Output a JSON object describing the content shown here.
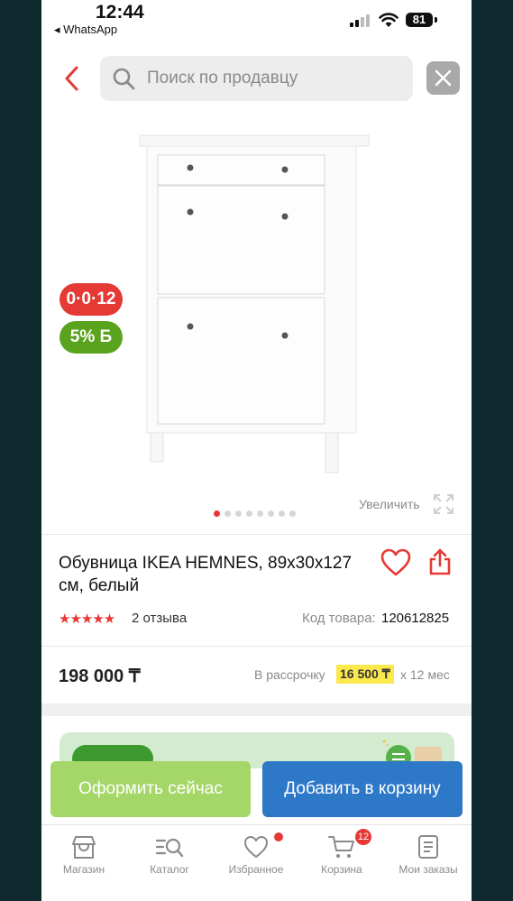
{
  "status_bar": {
    "time": "12:44",
    "back_app": "◂ WhatsApp",
    "battery": "81"
  },
  "search": {
    "placeholder": "Поиск по продавцу"
  },
  "badges": {
    "installment": "0·0·12",
    "bonus": "5%",
    "bonus_currency": "Б"
  },
  "gallery": {
    "zoom_label": "Увеличить",
    "dots_total": 8,
    "active_dot": 0
  },
  "product": {
    "title": "Обувница IKEA HEMNES, 89x30x127 см, белый",
    "rating": 5,
    "reviews": "2 отзыва",
    "code_label": "Код товара:",
    "code_value": "120612825",
    "price": "198 000 ₸",
    "installment_label": "В рассрочку",
    "installment_amount": "16 500 ₸",
    "installment_term": "х 12 мес"
  },
  "actions": {
    "buy_now": "Оформить сейчас",
    "add_to_cart": "Добавить в корзину"
  },
  "tabbar": {
    "items": [
      {
        "label": "Магазин",
        "icon": "shop-icon"
      },
      {
        "label": "Каталог",
        "icon": "catalog-search-icon"
      },
      {
        "label": "Избранное",
        "icon": "heart-icon"
      },
      {
        "label": "Корзина",
        "icon": "cart-icon"
      },
      {
        "label": "Мои заказы",
        "icon": "orders-icon"
      }
    ],
    "cart_count": "12"
  },
  "colors": {
    "accent_red": "#e53935",
    "green_button": "#a5d768",
    "blue_button": "#2e78c8",
    "bonus_green": "#5aa31e",
    "installment_highlight": "#fbe84d"
  }
}
